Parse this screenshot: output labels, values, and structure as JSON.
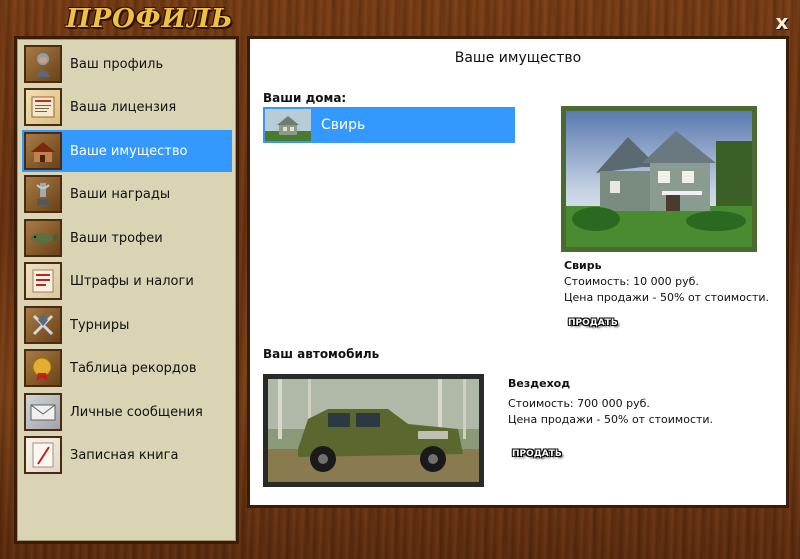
{
  "window": {
    "title": "ПРОФИЛЬ",
    "close_label": "x"
  },
  "sidebar": {
    "items": [
      {
        "label": "Ваш профиль",
        "icon": "fisherman-icon"
      },
      {
        "label": "Ваша лицензия",
        "icon": "license-icon"
      },
      {
        "label": "Ваше имущество",
        "icon": "house-icon",
        "active": true
      },
      {
        "label": "Ваши награды",
        "icon": "award-icon"
      },
      {
        "label": "Ваши трофеи",
        "icon": "fish-trophy-icon"
      },
      {
        "label": "Штрафы и налоги",
        "icon": "fines-icon"
      },
      {
        "label": "Турниры",
        "icon": "tournament-icon"
      },
      {
        "label": "Таблица рекордов",
        "icon": "records-icon"
      },
      {
        "label": "Личные сообщения",
        "icon": "envelope-icon"
      },
      {
        "label": "Записная книга",
        "icon": "notebook-icon"
      }
    ]
  },
  "main": {
    "title": "Ваше имущество",
    "houses": {
      "heading": "Ваши дома:",
      "items": [
        {
          "name": "Свирь"
        }
      ],
      "selected": {
        "name": "Свирь",
        "cost": "Стоимость: 10 000 руб.",
        "sale": "Цена продажи - 50% от стоимости.",
        "sell_label": "ПРОДАТЬ"
      }
    },
    "car": {
      "heading": "Ваш автомобиль",
      "name": "Вездеход",
      "cost": "Стоимость: 700 000 руб.",
      "sale": "Цена продажи - 50% от стоимости.",
      "sell_label": "ПРОДАТЬ"
    }
  },
  "colors": {
    "accent": "#3399ff",
    "sidebar_bg": "#d8d4b4",
    "title_gold": "#f0c040"
  }
}
